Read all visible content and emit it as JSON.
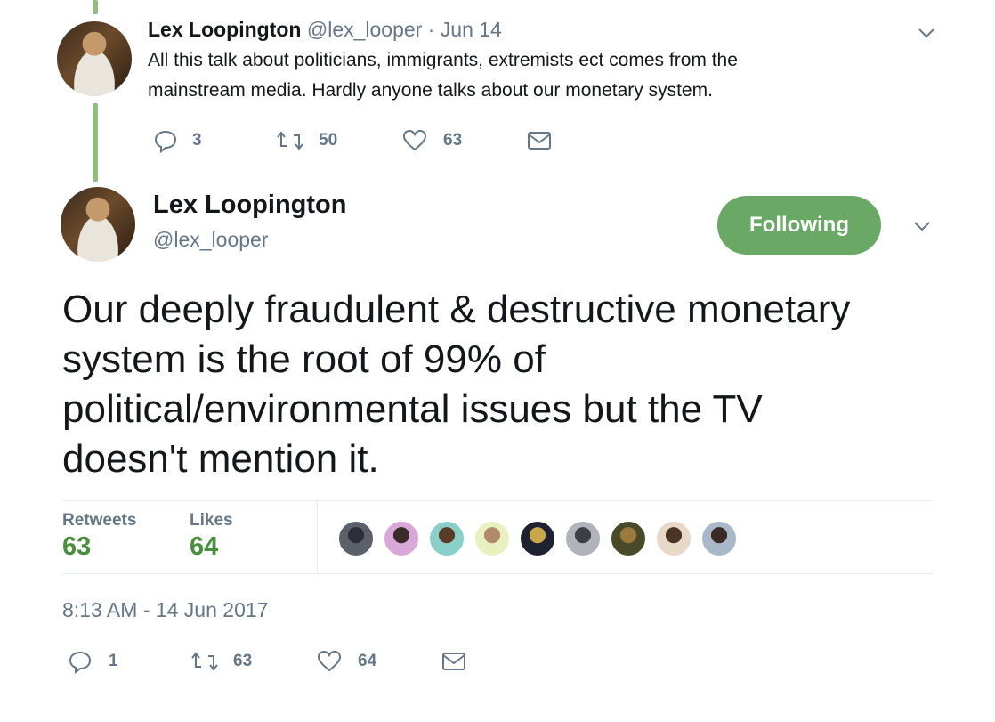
{
  "parent_tweet": {
    "display_name": "Lex Loopington",
    "handle": "@lex_looper",
    "separator": "·",
    "date": "Jun 14",
    "text_line1": "All this talk about politicians, immigrants, extremists ect comes from the",
    "text_line2": "mainstream media. Hardly anyone talks about our monetary system.",
    "replies": "3",
    "retweets": "50",
    "likes": "63"
  },
  "main_tweet": {
    "display_name": "Lex Loopington",
    "handle": "@lex_looper",
    "follow_label": "Following",
    "text_line1": "Our deeply fraudulent & destructive monetary",
    "text_line2": "system is the root of 99% of",
    "text_line3": "political/environmental issues but the TV",
    "text_line4": "doesn't mention it.",
    "stats": {
      "retweets_label": "Retweets",
      "retweets_value": "63",
      "likes_label": "Likes",
      "likes_value": "64"
    },
    "timestamp": "8:13 AM - 14 Jun 2017",
    "replies": "1",
    "retweets": "63",
    "likes": "64"
  },
  "colors": {
    "accent_green": "#6aa865",
    "stat_green": "#4a8f3c",
    "muted_gray": "#657786",
    "thread_line": "#8fbf7f"
  },
  "likers": [
    {
      "color_a": "#5a5f6a",
      "color_b": "#2c2f35"
    },
    {
      "color_a": "#d9a8d8",
      "color_b": "#3a2a2a"
    },
    {
      "color_a": "#8ad0c8",
      "color_b": "#5a3b28"
    },
    {
      "color_a": "#e8f0c0",
      "color_b": "#b08a6a"
    },
    {
      "color_a": "#1e2130",
      "color_b": "#c8a84a"
    },
    {
      "color_a": "#b0b4ba",
      "color_b": "#3c3f45"
    },
    {
      "color_a": "#4a4a2a",
      "color_b": "#9a7a3a"
    },
    {
      "color_a": "#e8d8c8",
      "color_b": "#4a3424"
    },
    {
      "color_a": "#a8b8c8",
      "color_b": "#3a2a28"
    }
  ]
}
